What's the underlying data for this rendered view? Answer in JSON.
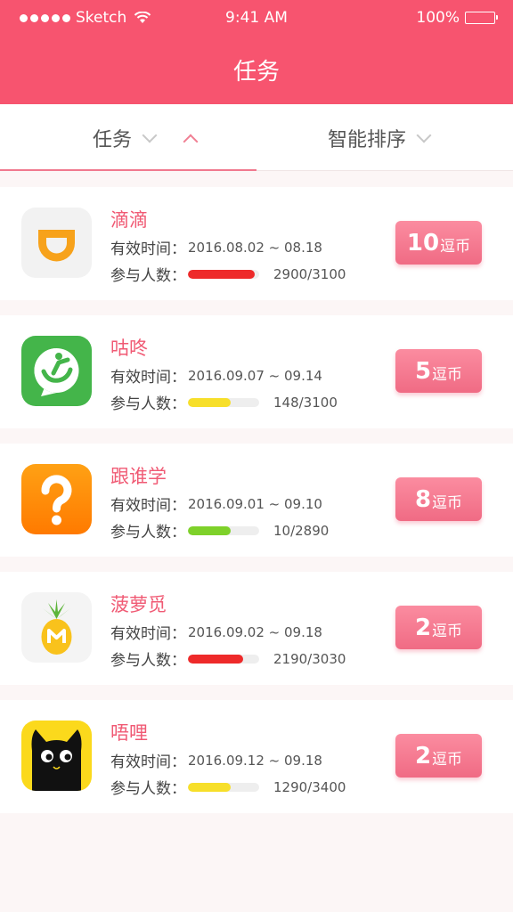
{
  "status_bar": {
    "carrier": "Sketch",
    "time": "9:41 AM",
    "battery": "100%"
  },
  "nav": {
    "title": "任务"
  },
  "filters": {
    "tab_task": "任务",
    "tab_sort": "智能排序"
  },
  "labels": {
    "valid_time": "有效时间：",
    "participants": "参与人数："
  },
  "tasks": [
    {
      "name": "滴滴",
      "time": "2016.08.02 ~ 08.18",
      "count": "2900/3100",
      "progress": 0.935,
      "bar_color": "#ee2a2a",
      "amount": "10",
      "unit": "逗币",
      "icon": "didi-icon"
    },
    {
      "name": "咕咚",
      "time": "2016.09.07 ~ 09.14",
      "count": "148/3100",
      "progress": 0.6,
      "bar_color": "#f7df2a",
      "amount": "5",
      "unit": "逗币",
      "icon": "codoon-icon"
    },
    {
      "name": "跟谁学",
      "time": "2016.09.01 ~ 09.10",
      "count": "10/2890",
      "progress": 0.6,
      "bar_color": "#7ed12a",
      "amount": "8",
      "unit": "逗币",
      "icon": "question-icon"
    },
    {
      "name": "菠萝觅",
      "time": "2016.09.02 ~ 09.18",
      "count": "2190/3030",
      "progress": 0.78,
      "bar_color": "#ee2a2a",
      "amount": "2",
      "unit": "逗币",
      "icon": "pineapple-icon"
    },
    {
      "name": "唔哩",
      "time": "2016.09.12 ~ 09.18",
      "count": "1290/3400",
      "progress": 0.6,
      "bar_color": "#f7df2a",
      "amount": "2",
      "unit": "逗币",
      "icon": "black-cat-icon"
    }
  ],
  "colors": {
    "brand": "#f7546f",
    "accent_text": "#f05a74",
    "button": "#f06b84"
  }
}
